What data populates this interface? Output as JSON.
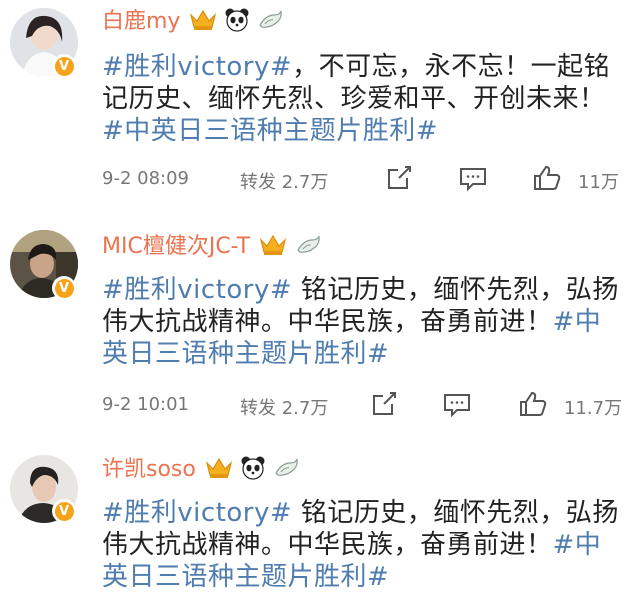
{
  "posts": [
    {
      "username": "白鹿my",
      "content_parts": [
        {
          "text": "#胜利victory#",
          "link": true
        },
        {
          "text": "，不可忘，永不忘！一起铭",
          "link": false
        },
        {
          "text": "记历史、缅怀先烈、珍爱和平、开创未来！",
          "link": false
        },
        {
          "text": "#中英日三语种主题片胜利#",
          "link": true
        }
      ],
      "time": "9-2 08:09",
      "repost_label": "转发",
      "repost_count": "2.7万",
      "like_count": "11万"
    },
    {
      "username": "MIC檀健次JC-T",
      "content_parts": [
        {
          "text": "#胜利victory#",
          "link": true
        },
        {
          "text": " 铭记历史，缅怀先烈，弘扬",
          "link": false
        },
        {
          "text": "伟大抗战精神。中华民族，奋勇前进！",
          "link": false
        },
        {
          "text": "#中",
          "link": true
        },
        {
          "text": "英日三语种主题片胜利#",
          "link": true
        }
      ],
      "time": "9-2 10:01",
      "repost_label": "转发",
      "repost_count": "2.7万",
      "like_count": "11.7万"
    },
    {
      "username": "许凯soso",
      "content_parts": [
        {
          "text": "#胜利victory#",
          "link": true
        },
        {
          "text": " 铭记历史，缅怀先烈，弘扬",
          "link": false
        },
        {
          "text": "伟大抗战精神。中华民族，奋勇前进！",
          "link": false
        },
        {
          "text": "#中",
          "link": true
        },
        {
          "text": "英日三语种主题片胜利#",
          "link": true
        }
      ]
    }
  ],
  "colors": {
    "username": "#eb7350",
    "topic_link": "#507daf",
    "verified_badge": "#f7a21b",
    "meta_text": "#777777"
  },
  "icons": [
    "crown-vip-icon",
    "panda-icon",
    "bird-icon",
    "verified-badge-icon",
    "share-icon",
    "comment-icon",
    "like-icon"
  ]
}
